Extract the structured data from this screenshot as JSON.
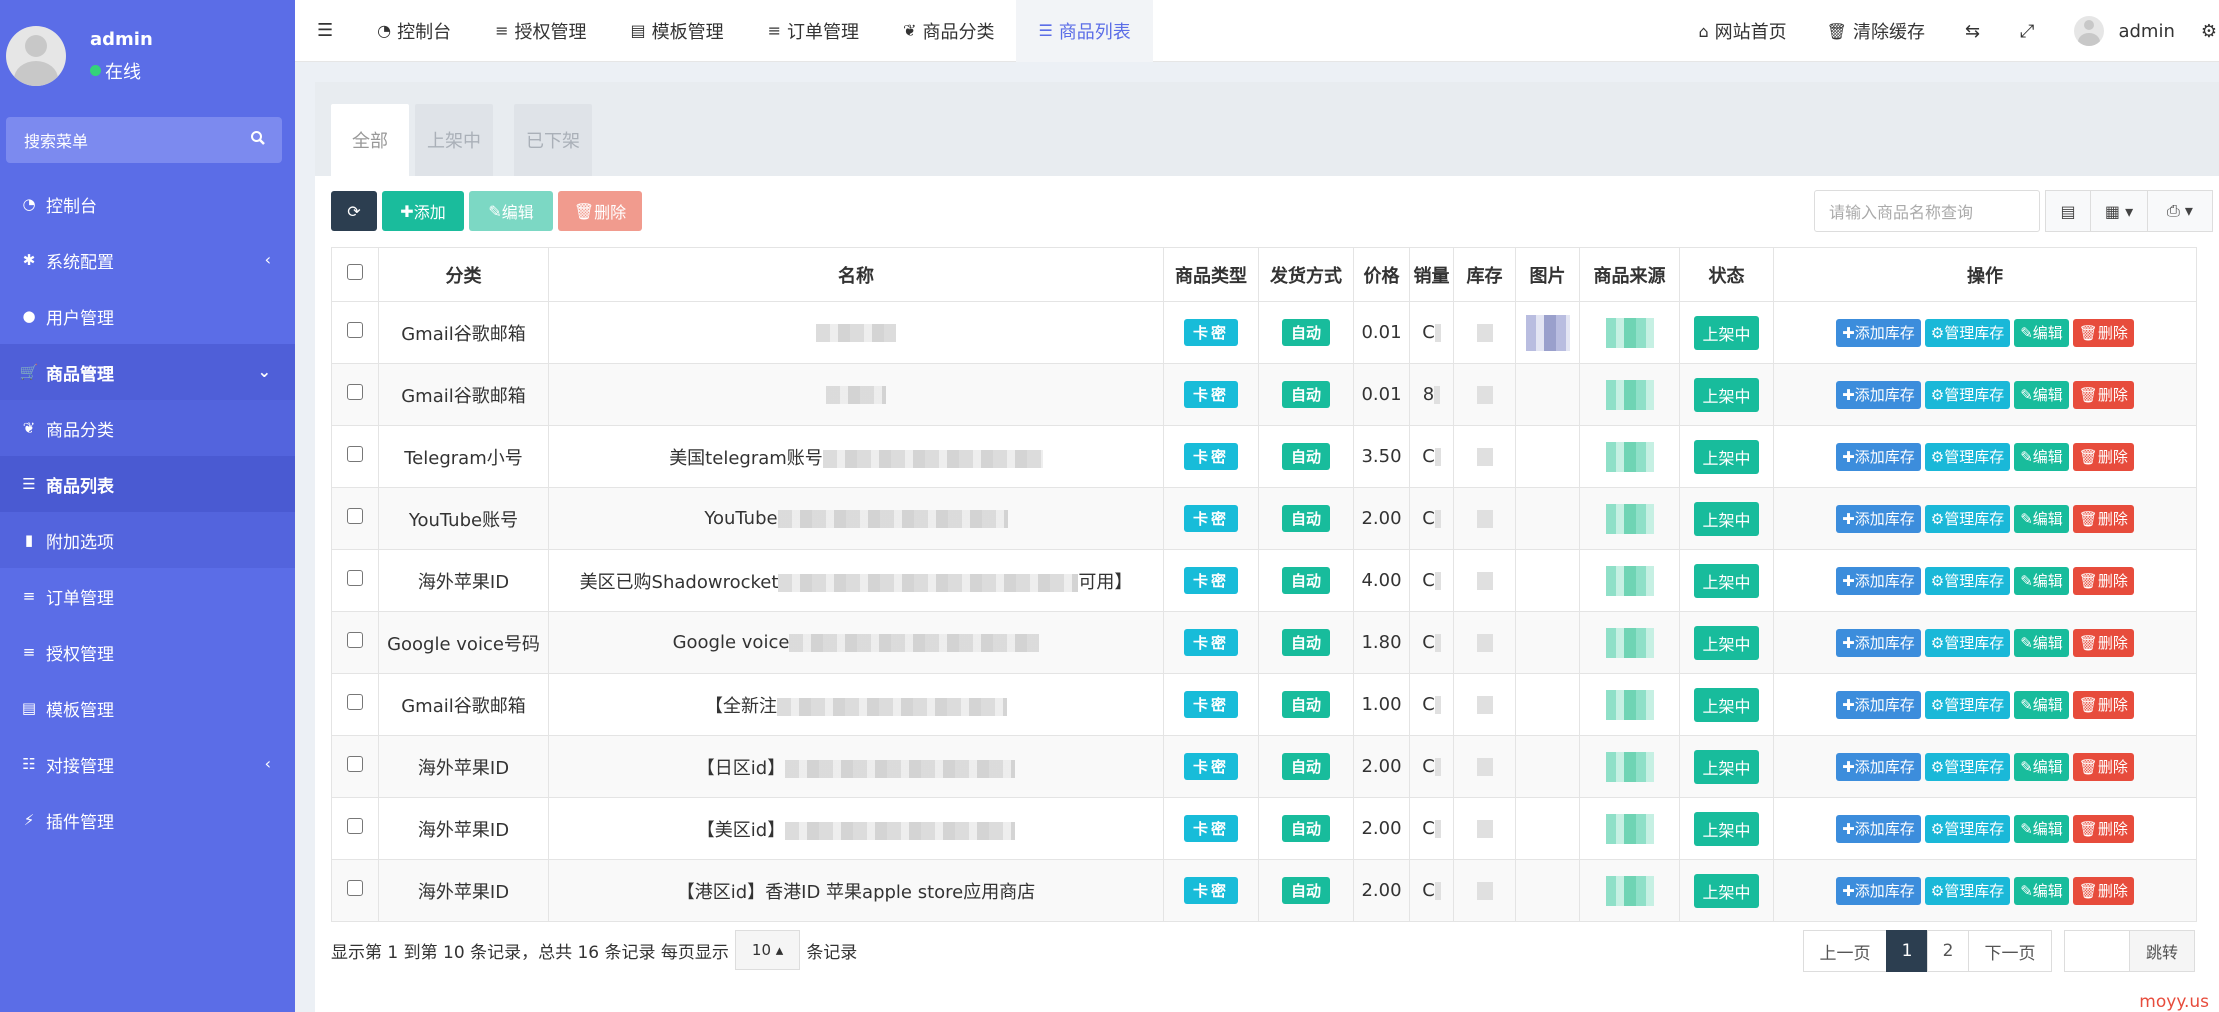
{
  "sidebar": {
    "user_name": "admin",
    "user_status": "在线",
    "search_placeholder": "搜索菜单",
    "items": [
      {
        "label": "控制台",
        "icon": "dashboard-icon"
      },
      {
        "label": "系统配置",
        "icon": "gear-icon"
      },
      {
        "label": "用户管理",
        "icon": "user-icon"
      },
      {
        "label": "商品管理",
        "icon": "cart-icon"
      },
      {
        "label": "商品分类",
        "icon": "leaf-icon"
      },
      {
        "label": "商品列表",
        "icon": "list-icon"
      },
      {
        "label": "附加选项",
        "icon": "bookmark-icon"
      },
      {
        "label": "订单管理",
        "icon": "bars-icon"
      },
      {
        "label": "授权管理",
        "icon": "bars-icon"
      },
      {
        "label": "模板管理",
        "icon": "list-alt-icon"
      },
      {
        "label": "对接管理",
        "icon": "sliders-icon"
      },
      {
        "label": "插件管理",
        "icon": "plug-icon"
      }
    ]
  },
  "topnav": {
    "items": [
      {
        "label": "控制台"
      },
      {
        "label": "授权管理"
      },
      {
        "label": "模板管理"
      },
      {
        "label": "订单管理"
      },
      {
        "label": "商品分类"
      },
      {
        "label": "商品列表"
      }
    ],
    "home": "网站首页",
    "clear_cache": "清除缓存",
    "user": "admin"
  },
  "tabs": [
    "全部",
    "上架中",
    "已下架"
  ],
  "toolbar": {
    "add": "添加",
    "edit": "编辑",
    "delete": "删除",
    "search_placeholder": "请输入商品名称查询"
  },
  "table": {
    "headers": [
      "分类",
      "名称",
      "商品类型",
      "发货方式",
      "价格",
      "销量",
      "库存",
      "图片",
      "商品来源",
      "状态",
      "操作"
    ],
    "rows": [
      {
        "category": "Gmail谷歌邮箱",
        "name": "",
        "type": "卡密",
        "delivery": "自动",
        "price": "0.01",
        "sales": "C",
        "status": "上架中"
      },
      {
        "category": "Gmail谷歌邮箱",
        "name": "",
        "type": "卡密",
        "delivery": "自动",
        "price": "0.01",
        "sales": "8",
        "status": "上架中"
      },
      {
        "category": "Telegram小号",
        "name": "美国telegram账号",
        "type": "卡密",
        "delivery": "自动",
        "price": "3.50",
        "sales": "C",
        "status": "上架中"
      },
      {
        "category": "YouTube账号",
        "name": "YouTube",
        "type": "卡密",
        "delivery": "自动",
        "price": "2.00",
        "sales": "C",
        "status": "上架中"
      },
      {
        "category": "海外苹果ID",
        "name": "美区已购Shadowrocket",
        "name_tail": "可用】",
        "type": "卡密",
        "delivery": "自动",
        "price": "4.00",
        "sales": "C",
        "status": "上架中"
      },
      {
        "category": "Google voice号码",
        "name": "Google voice",
        "type": "卡密",
        "delivery": "自动",
        "price": "1.80",
        "sales": "C",
        "status": "上架中"
      },
      {
        "category": "Gmail谷歌邮箱",
        "name": "【全新注",
        "type": "卡密",
        "delivery": "自动",
        "price": "1.00",
        "sales": "C",
        "status": "上架中"
      },
      {
        "category": "海外苹果ID",
        "name": "【日区id】",
        "type": "卡密",
        "delivery": "自动",
        "price": "2.00",
        "sales": "C",
        "status": "上架中"
      },
      {
        "category": "海外苹果ID",
        "name": "【美区id】",
        "type": "卡密",
        "delivery": "自动",
        "price": "2.00",
        "sales": "C",
        "status": "上架中"
      },
      {
        "category": "海外苹果ID",
        "name": "【港区id】香港ID 苹果apple store应用商店",
        "type": "卡密",
        "delivery": "自动",
        "price": "2.00",
        "sales": "C",
        "status": "上架中"
      }
    ],
    "ops": {
      "add_stock": "添加库存",
      "manage_stock": "管理库存",
      "edit": "编辑",
      "delete": "删除"
    }
  },
  "footer": {
    "info_prefix": "显示第 1 到第 10 条记录，总共 16 条记录 每页显示",
    "page_size": "10",
    "info_suffix": "条记录",
    "prev": "上一页",
    "page1": "1",
    "page2": "2",
    "next": "下一页",
    "jump": "跳转"
  },
  "watermark": "moyy.us"
}
